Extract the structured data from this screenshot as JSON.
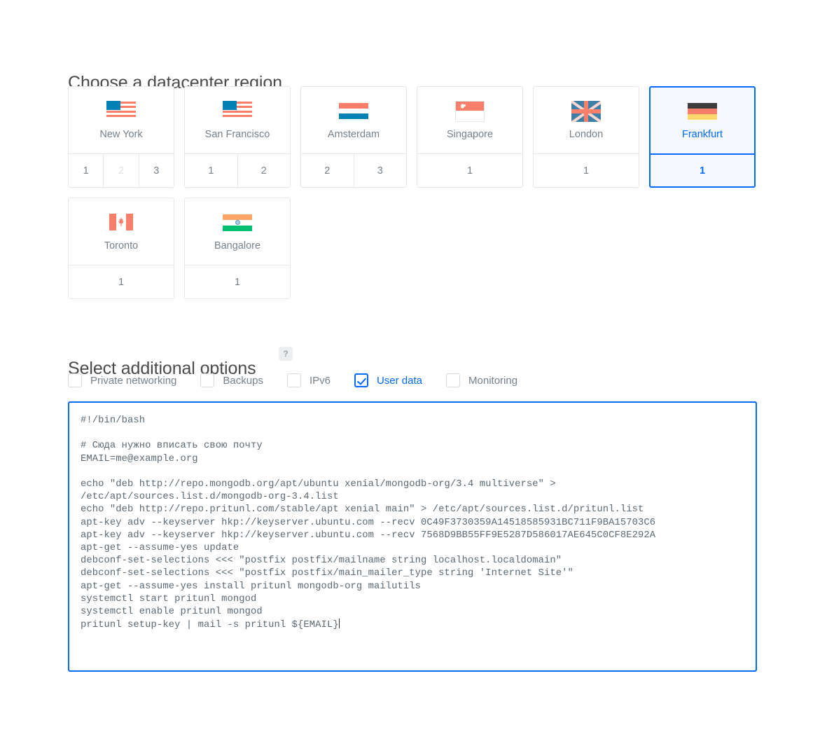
{
  "region_section": {
    "heading": "Choose a datacenter region",
    "regions": [
      {
        "name": "New York",
        "flag": "flag-us",
        "selected": false,
        "datacenters": [
          {
            "label": "1",
            "disabled": false
          },
          {
            "label": "2",
            "disabled": true
          },
          {
            "label": "3",
            "disabled": false
          }
        ]
      },
      {
        "name": "San Francisco",
        "flag": "flag-us",
        "selected": false,
        "datacenters": [
          {
            "label": "1",
            "disabled": false
          },
          {
            "label": "2",
            "disabled": false
          }
        ]
      },
      {
        "name": "Amsterdam",
        "flag": "flag-nl",
        "selected": false,
        "datacenters": [
          {
            "label": "2",
            "disabled": false
          },
          {
            "label": "3",
            "disabled": false
          }
        ]
      },
      {
        "name": "Singapore",
        "flag": "flag-sg",
        "selected": false,
        "datacenters": [
          {
            "label": "1",
            "disabled": false
          }
        ]
      },
      {
        "name": "London",
        "flag": "flag-uk",
        "selected": false,
        "datacenters": [
          {
            "label": "1",
            "disabled": false
          }
        ]
      },
      {
        "name": "Frankfurt",
        "flag": "flag-de",
        "selected": true,
        "datacenters": [
          {
            "label": "1",
            "disabled": false
          }
        ]
      },
      {
        "name": "Toronto",
        "flag": "flag-ca",
        "selected": false,
        "datacenters": [
          {
            "label": "1",
            "disabled": false
          }
        ]
      },
      {
        "name": "Bangalore",
        "flag": "flag-in",
        "selected": false,
        "datacenters": [
          {
            "label": "1",
            "disabled": false
          }
        ]
      }
    ]
  },
  "options_section": {
    "heading": "Select additional options",
    "help_badge": "?",
    "options": [
      {
        "label": "Private networking",
        "checked": false
      },
      {
        "label": "Backups",
        "checked": false
      },
      {
        "label": "IPv6",
        "checked": false
      },
      {
        "label": "User data",
        "checked": true
      },
      {
        "label": "Monitoring",
        "checked": false
      }
    ]
  },
  "user_data": {
    "script": "#!/bin/bash\n\n# Сюда нужно вписать свою почту\nEMAIL=me@example.org\n\necho \"deb http://repo.mongodb.org/apt/ubuntu xenial/mongodb-org/3.4 multiverse\" >\n/etc/apt/sources.list.d/mongodb-org-3.4.list\necho \"deb http://repo.pritunl.com/stable/apt xenial main\" > /etc/apt/sources.list.d/pritunl.list\napt-key adv --keyserver hkp://keyserver.ubuntu.com --recv 0C49F3730359A14518585931BC711F9BA15703C6\napt-key adv --keyserver hkp://keyserver.ubuntu.com --recv 7568D9BB55FF9E5287D586017AE645C0CF8E292A\napt-get --assume-yes update\ndebconf-set-selections <<< \"postfix postfix/mailname string localhost.localdomain\"\ndebconf-set-selections <<< \"postfix postfix/main_mailer_type string 'Internet Site'\"\napt-get --assume-yes install pritunl mongodb-org mailutils\nsystemctl start pritunl mongod\nsystemctl enable pritunl mongod\npritunl setup-key | mail -s pritunl ${EMAIL}"
  },
  "colors": {
    "accent": "#0069ff",
    "text_muted": "#76818a",
    "border": "#e3e7ea",
    "selected_bg": "#f5f9ff",
    "flag_coral": "#fa7f6a",
    "flag_blue": "#0081b5"
  }
}
